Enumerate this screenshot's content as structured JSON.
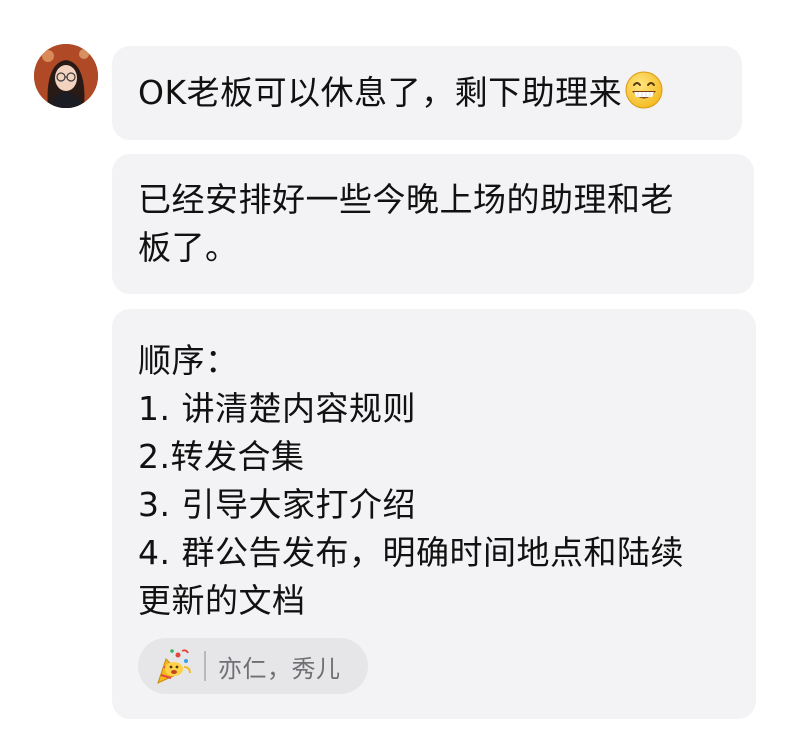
{
  "messages": [
    {
      "lines": [
        "OK老板可以休息了，剩下助理来"
      ],
      "trailing_emoji": "grinning-face-icon"
    },
    {
      "lines": [
        "已经安排好一些今晚上场的助理和老",
        "板了。"
      ]
    },
    {
      "lines": [
        "顺序：",
        "1. 讲清楚内容规则",
        "2.转发合集",
        "3. 引导大家打介绍",
        "4. 群公告发布，明确时间地点和陆续",
        "更新的文档"
      ]
    }
  ],
  "reaction": {
    "emoji": "party-popper-icon",
    "names": "亦仁，秀儿"
  },
  "colors": {
    "bubble_bg": "#f3f3f5",
    "reaction_bg": "#e6e6e8",
    "reaction_text": "#6f6f74"
  }
}
